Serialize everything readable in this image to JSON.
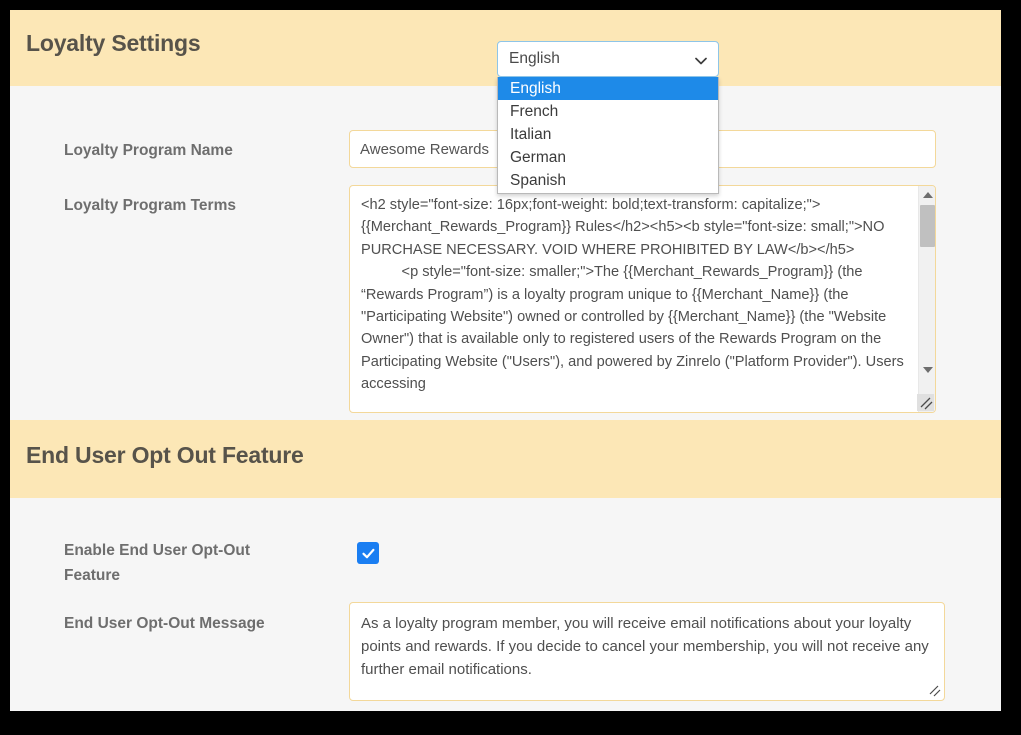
{
  "sections": [
    {
      "title": "Loyalty Settings",
      "language_select": {
        "value": "English",
        "options": [
          "English",
          "French",
          "Italian",
          "German",
          "Spanish"
        ],
        "selected_index": 0
      },
      "fields": [
        {
          "label": "Loyalty Program Name",
          "value": "Awesome Rewards"
        },
        {
          "label": "Loyalty Program Terms",
          "value": "<h2 style=\"font-size: 16px;font-weight: bold;text-transform: capitalize;\">{{Merchant_Rewards_Program}} Rules</h2><h5><b style=\"font-size: small;\">NO PURCHASE NECESSARY. VOID WHERE PROHIBITED BY LAW</b></h5>\n          <p style=\"font-size: smaller;\">The {{Merchant_Rewards_Program}} (the “Rewards Program”) is a loyalty program unique to {{Merchant_Name}} (the \"Participating Website\") owned or controlled by {{Merchant_Name}} (the \"Website Owner\") that is available only to registered users of the Rewards Program on the Participating Website (\"Users\"), and powered by Zinrelo (\"Platform Provider\"). Users accessing"
        }
      ]
    },
    {
      "title": "End User Opt Out Feature",
      "fields": [
        {
          "label": "Enable End User Opt-Out Feature",
          "checkbox_checked": true
        },
        {
          "label": "End User Opt-Out Message",
          "value": "As a loyalty program member, you will receive email notifications about your loyalty points and rewards. If you decide to cancel your membership, you will not receive any further email notifications."
        }
      ]
    }
  ],
  "icons": {
    "chevron_down": "chevron-down-icon",
    "scroll_up": "scroll-up-arrow-icon",
    "scroll_down": "scroll-down-arrow-icon",
    "resize": "resize-grip-icon",
    "check": "check-icon"
  },
  "colors": {
    "band": "#fce7b6",
    "accent_checkbox": "#1a7ef2",
    "select_highlight": "#1e8ae8",
    "input_border": "#f3d89a",
    "page_background": "#f6f6f6"
  }
}
